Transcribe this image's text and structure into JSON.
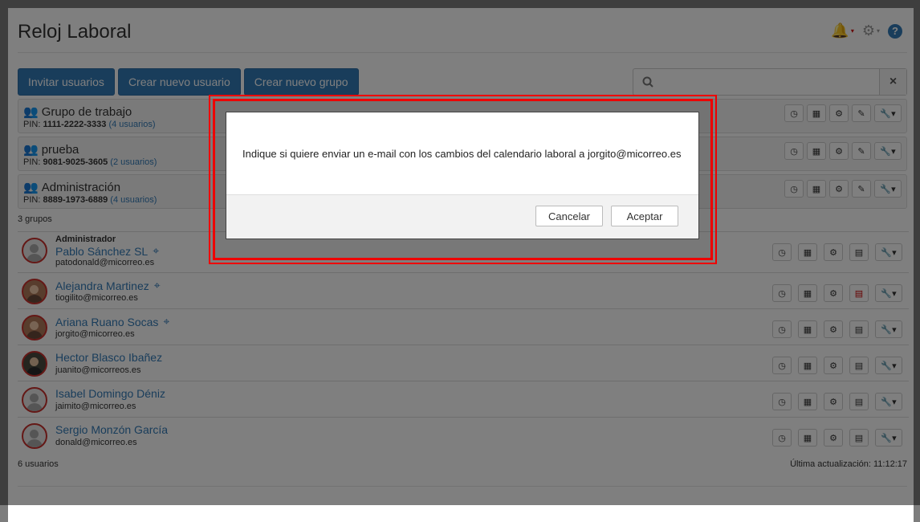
{
  "header": {
    "title": "Reloj Laboral"
  },
  "toolbar": {
    "invite_label": "Invitar usuarios",
    "new_user_label": "Crear nuevo usuario",
    "new_group_label": "Crear nuevo grupo",
    "search_placeholder": "",
    "clear_icon": "×"
  },
  "groups": [
    {
      "name": "Grupo de trabajo",
      "pin_prefix": "PIN:",
      "pin": "1111-2222-3333",
      "members": "(4 usuarios)"
    },
    {
      "name": "prueba",
      "pin_prefix": "PIN:",
      "pin": "9081-9025-3605",
      "members": "(2 usuarios)"
    },
    {
      "name": "Administración",
      "pin_prefix": "PIN:",
      "pin": "8889-1973-6889",
      "members": "(4 usuarios)"
    }
  ],
  "groups_count": "3 grupos",
  "users": [
    {
      "role": "Administrador",
      "name": "Pablo Sánchez SL",
      "email": "patodonald@micorreo.es"
    },
    {
      "role": "",
      "name": "Alejandra Martinez",
      "email": "tiogilito@micorreo.es"
    },
    {
      "role": "",
      "name": "Ariana Ruano Socas",
      "email": "jorgito@micorreo.es"
    },
    {
      "role": "",
      "name": "Hector Blasco Ibañez",
      "email": "juanito@micorreos.es"
    },
    {
      "role": "",
      "name": "Isabel Domingo Déniz",
      "email": "jaimito@micorreo.es"
    },
    {
      "role": "",
      "name": "Sergio Monzón García",
      "email": "donald@micorreo.es"
    }
  ],
  "users_count": "6 usuarios",
  "last_update": "Última actualización: 11:12:17",
  "modal": {
    "message": "Indique si quiere enviar un e-mail con los cambios del calendario laboral a jorgito@micorreo.es",
    "cancel_label": "Cancelar",
    "accept_label": "Aceptar"
  },
  "icons": {
    "bell": "bell-icon",
    "gear": "gear-icon",
    "help": "help-icon",
    "search": "search-icon",
    "group": "users-icon",
    "clock": "clock-icon",
    "calendar": "calendar-icon",
    "settings": "gear-icon",
    "edit": "pencil-icon",
    "tools": "wrench-icon",
    "document": "document-icon",
    "location": "map-pin-icon"
  },
  "colors": {
    "accent": "#337ab7",
    "alert": "#cc0000"
  }
}
